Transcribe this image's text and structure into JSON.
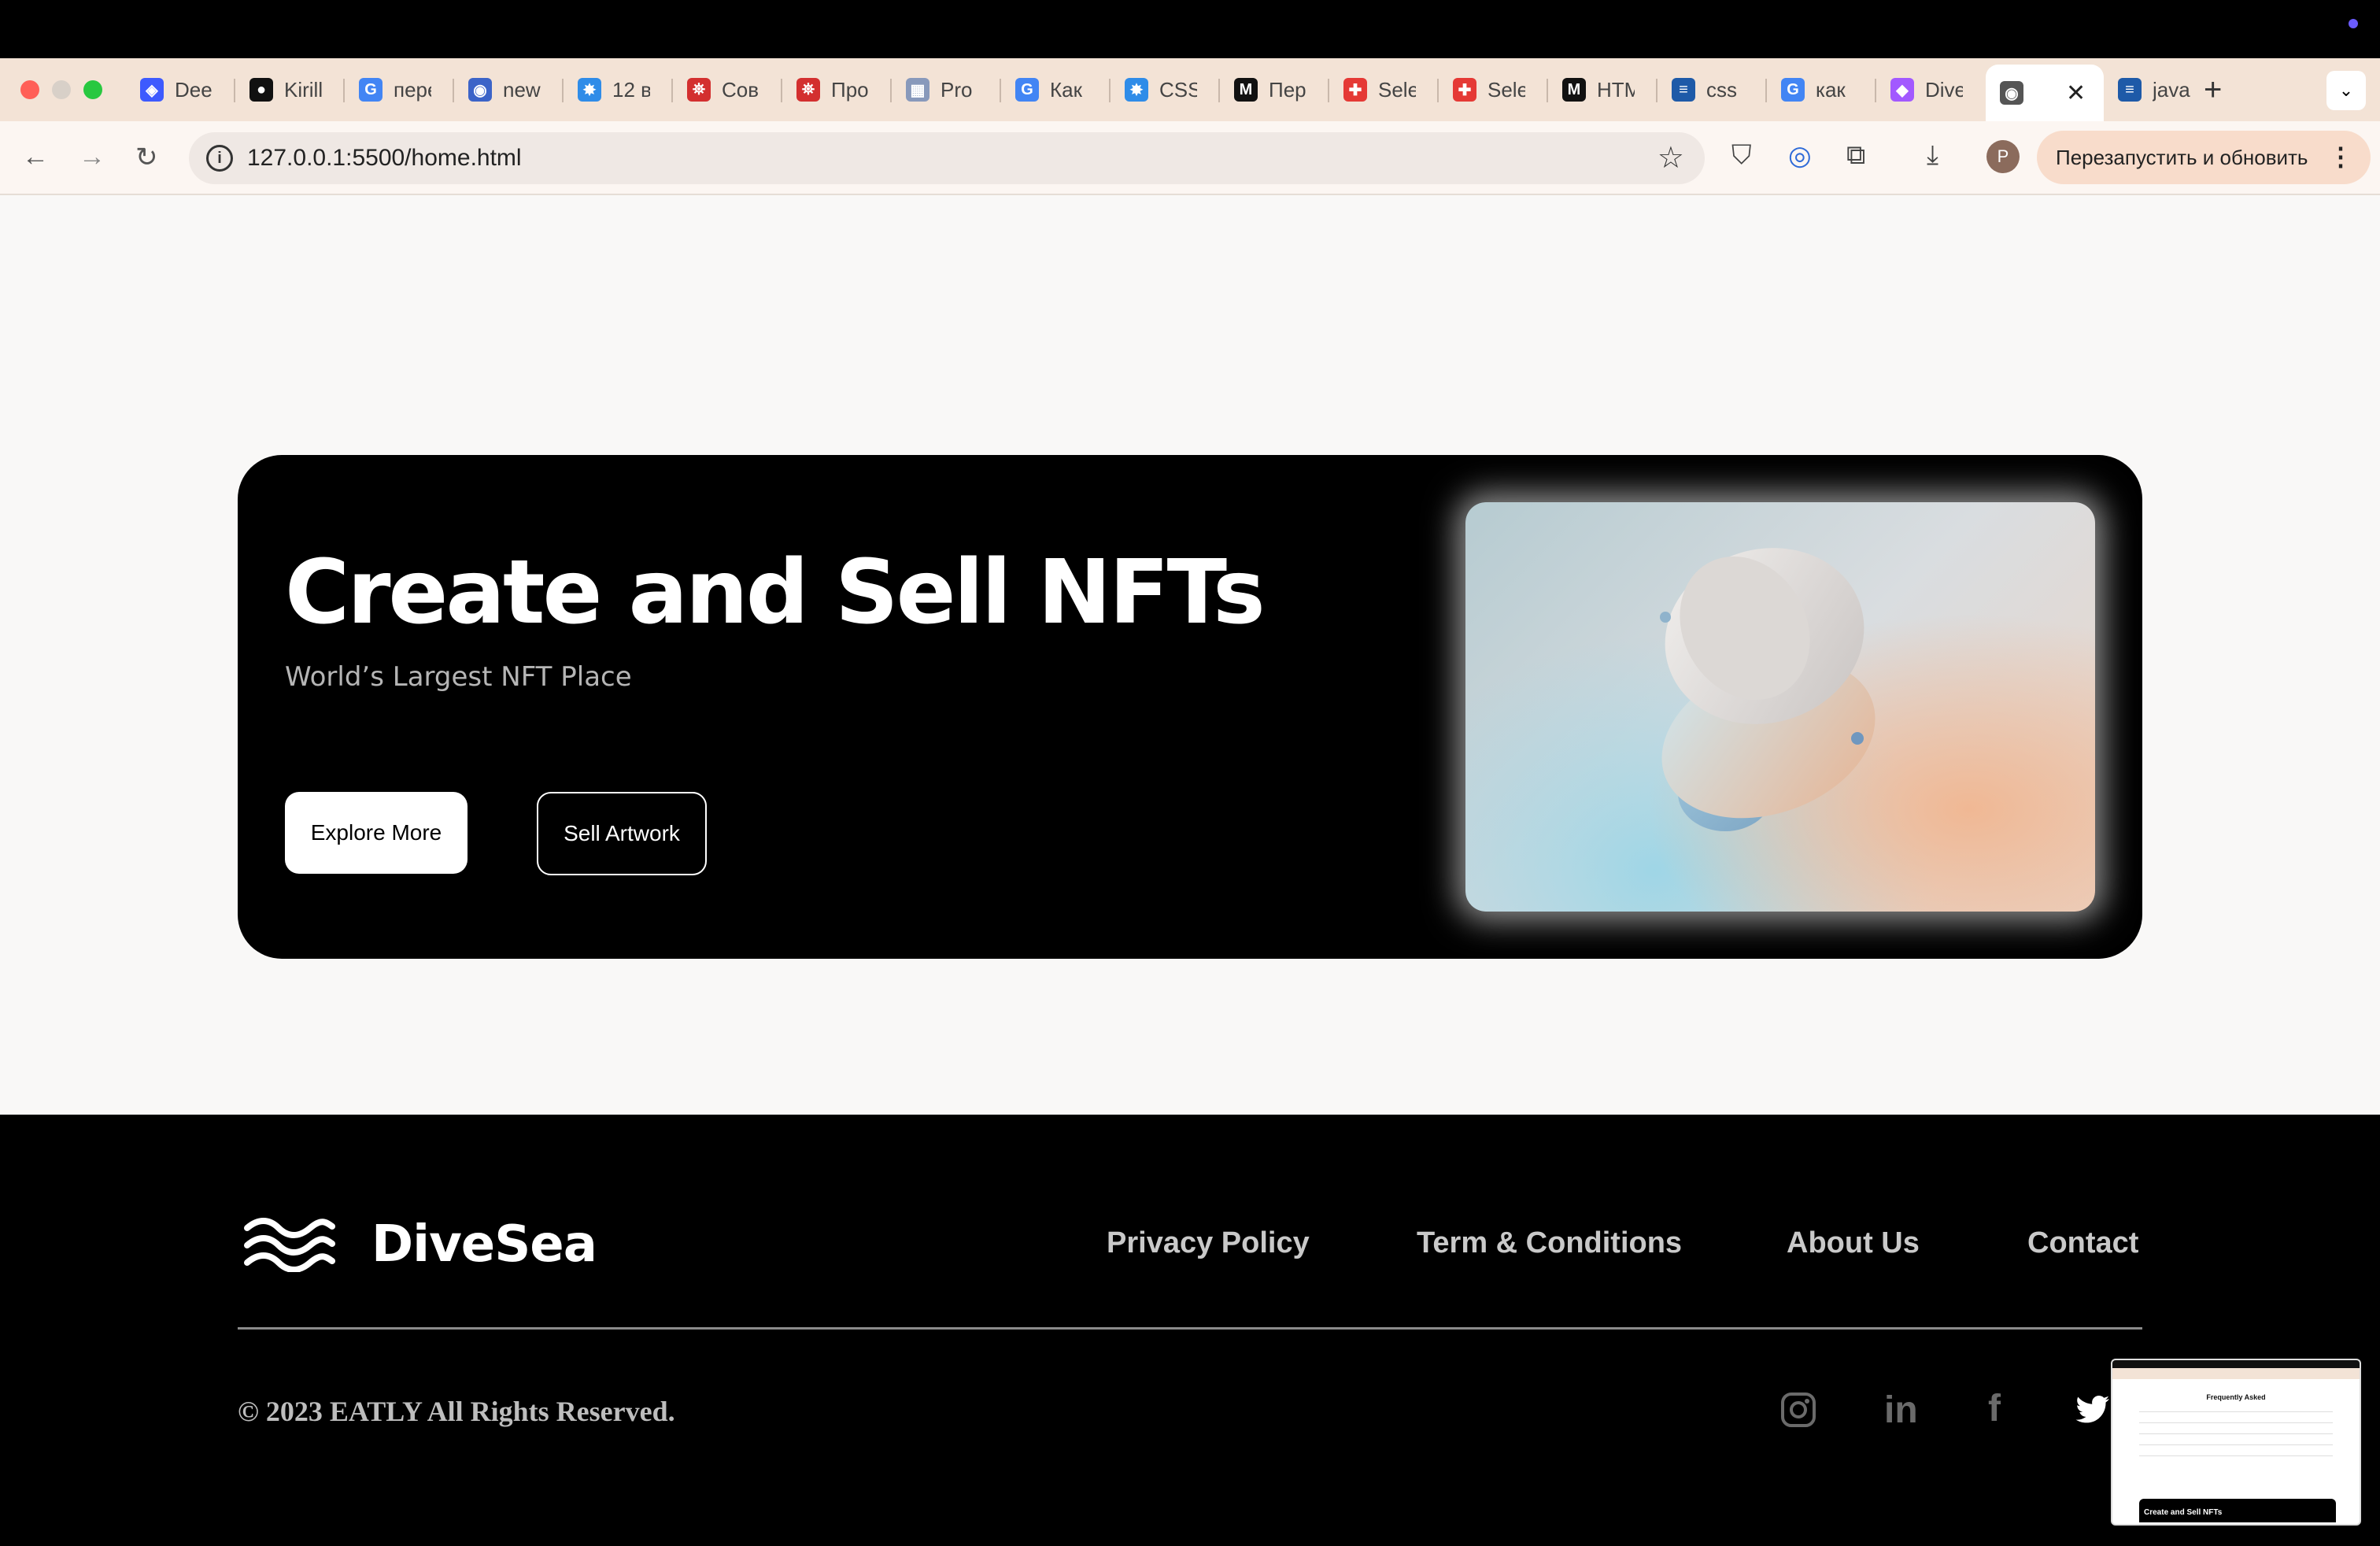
{
  "browser": {
    "tabs": [
      {
        "label": "Dee",
        "icon": "deepl-icon",
        "color": "#3d5afe"
      },
      {
        "label": "Kirill",
        "icon": "github-icon",
        "color": "#111111"
      },
      {
        "label": "пере",
        "icon": "google-icon",
        "color": "#4285f4"
      },
      {
        "label": "new",
        "icon": "globe-icon",
        "color": "#3c64c8"
      },
      {
        "label": "12 в",
        "icon": "gear-icon",
        "color": "#2f8ce8"
      },
      {
        "label": "Сов",
        "icon": "figure-icon",
        "color": "#d32f2f"
      },
      {
        "label": "Про",
        "icon": "figure-icon",
        "color": "#d32f2f"
      },
      {
        "label": "Pro",
        "icon": "grid-icon",
        "color": "#8899bb"
      },
      {
        "label": "Как",
        "icon": "google-icon",
        "color": "#4285f4"
      },
      {
        "label": "CSS",
        "icon": "gear-icon",
        "color": "#2f8ce8"
      },
      {
        "label": "Пер",
        "icon": "m-icon",
        "color": "#111111"
      },
      {
        "label": "Sele",
        "icon": "colorful-icon",
        "color": "#e53935"
      },
      {
        "label": "Sele",
        "icon": "colorful-icon",
        "color": "#e53935"
      },
      {
        "label": "HTM",
        "icon": "m-icon",
        "color": "#111111"
      },
      {
        "label": "css",
        "icon": "stack-icon",
        "color": "#1e5aa8"
      },
      {
        "label": "как",
        "icon": "google-icon",
        "color": "#4285f4"
      },
      {
        "label": "Dive",
        "icon": "figma-icon",
        "color": "#a259ff"
      },
      {
        "label": "",
        "icon": "globe-icon",
        "color": "#555555",
        "active": true
      },
      {
        "label": "java",
        "icon": "stack-icon",
        "color": "#1e5aa8"
      }
    ],
    "url": "127.0.0.1:5500/home.html",
    "relaunch_label": "Перезапустить и обновить",
    "avatar_letter": "P"
  },
  "hero": {
    "title": "Create and Sell NFTs",
    "subtitle": "World’s Largest NFT Place",
    "explore_label": "Explore More",
    "sell_label": "Sell Artwork"
  },
  "footer": {
    "brand": "DiveSea",
    "links": [
      "Privacy Policy",
      "Term & Conditions",
      "About Us",
      "Contact"
    ],
    "copyright": "© 2023 EATLY All Rights Reserved.",
    "social": [
      "instagram-icon",
      "linkedin-icon",
      "facebook-icon",
      "twitter-icon"
    ]
  },
  "thumbnail": {
    "heading": "Frequently Asked",
    "hero_label": "Create and Sell NFTs"
  }
}
